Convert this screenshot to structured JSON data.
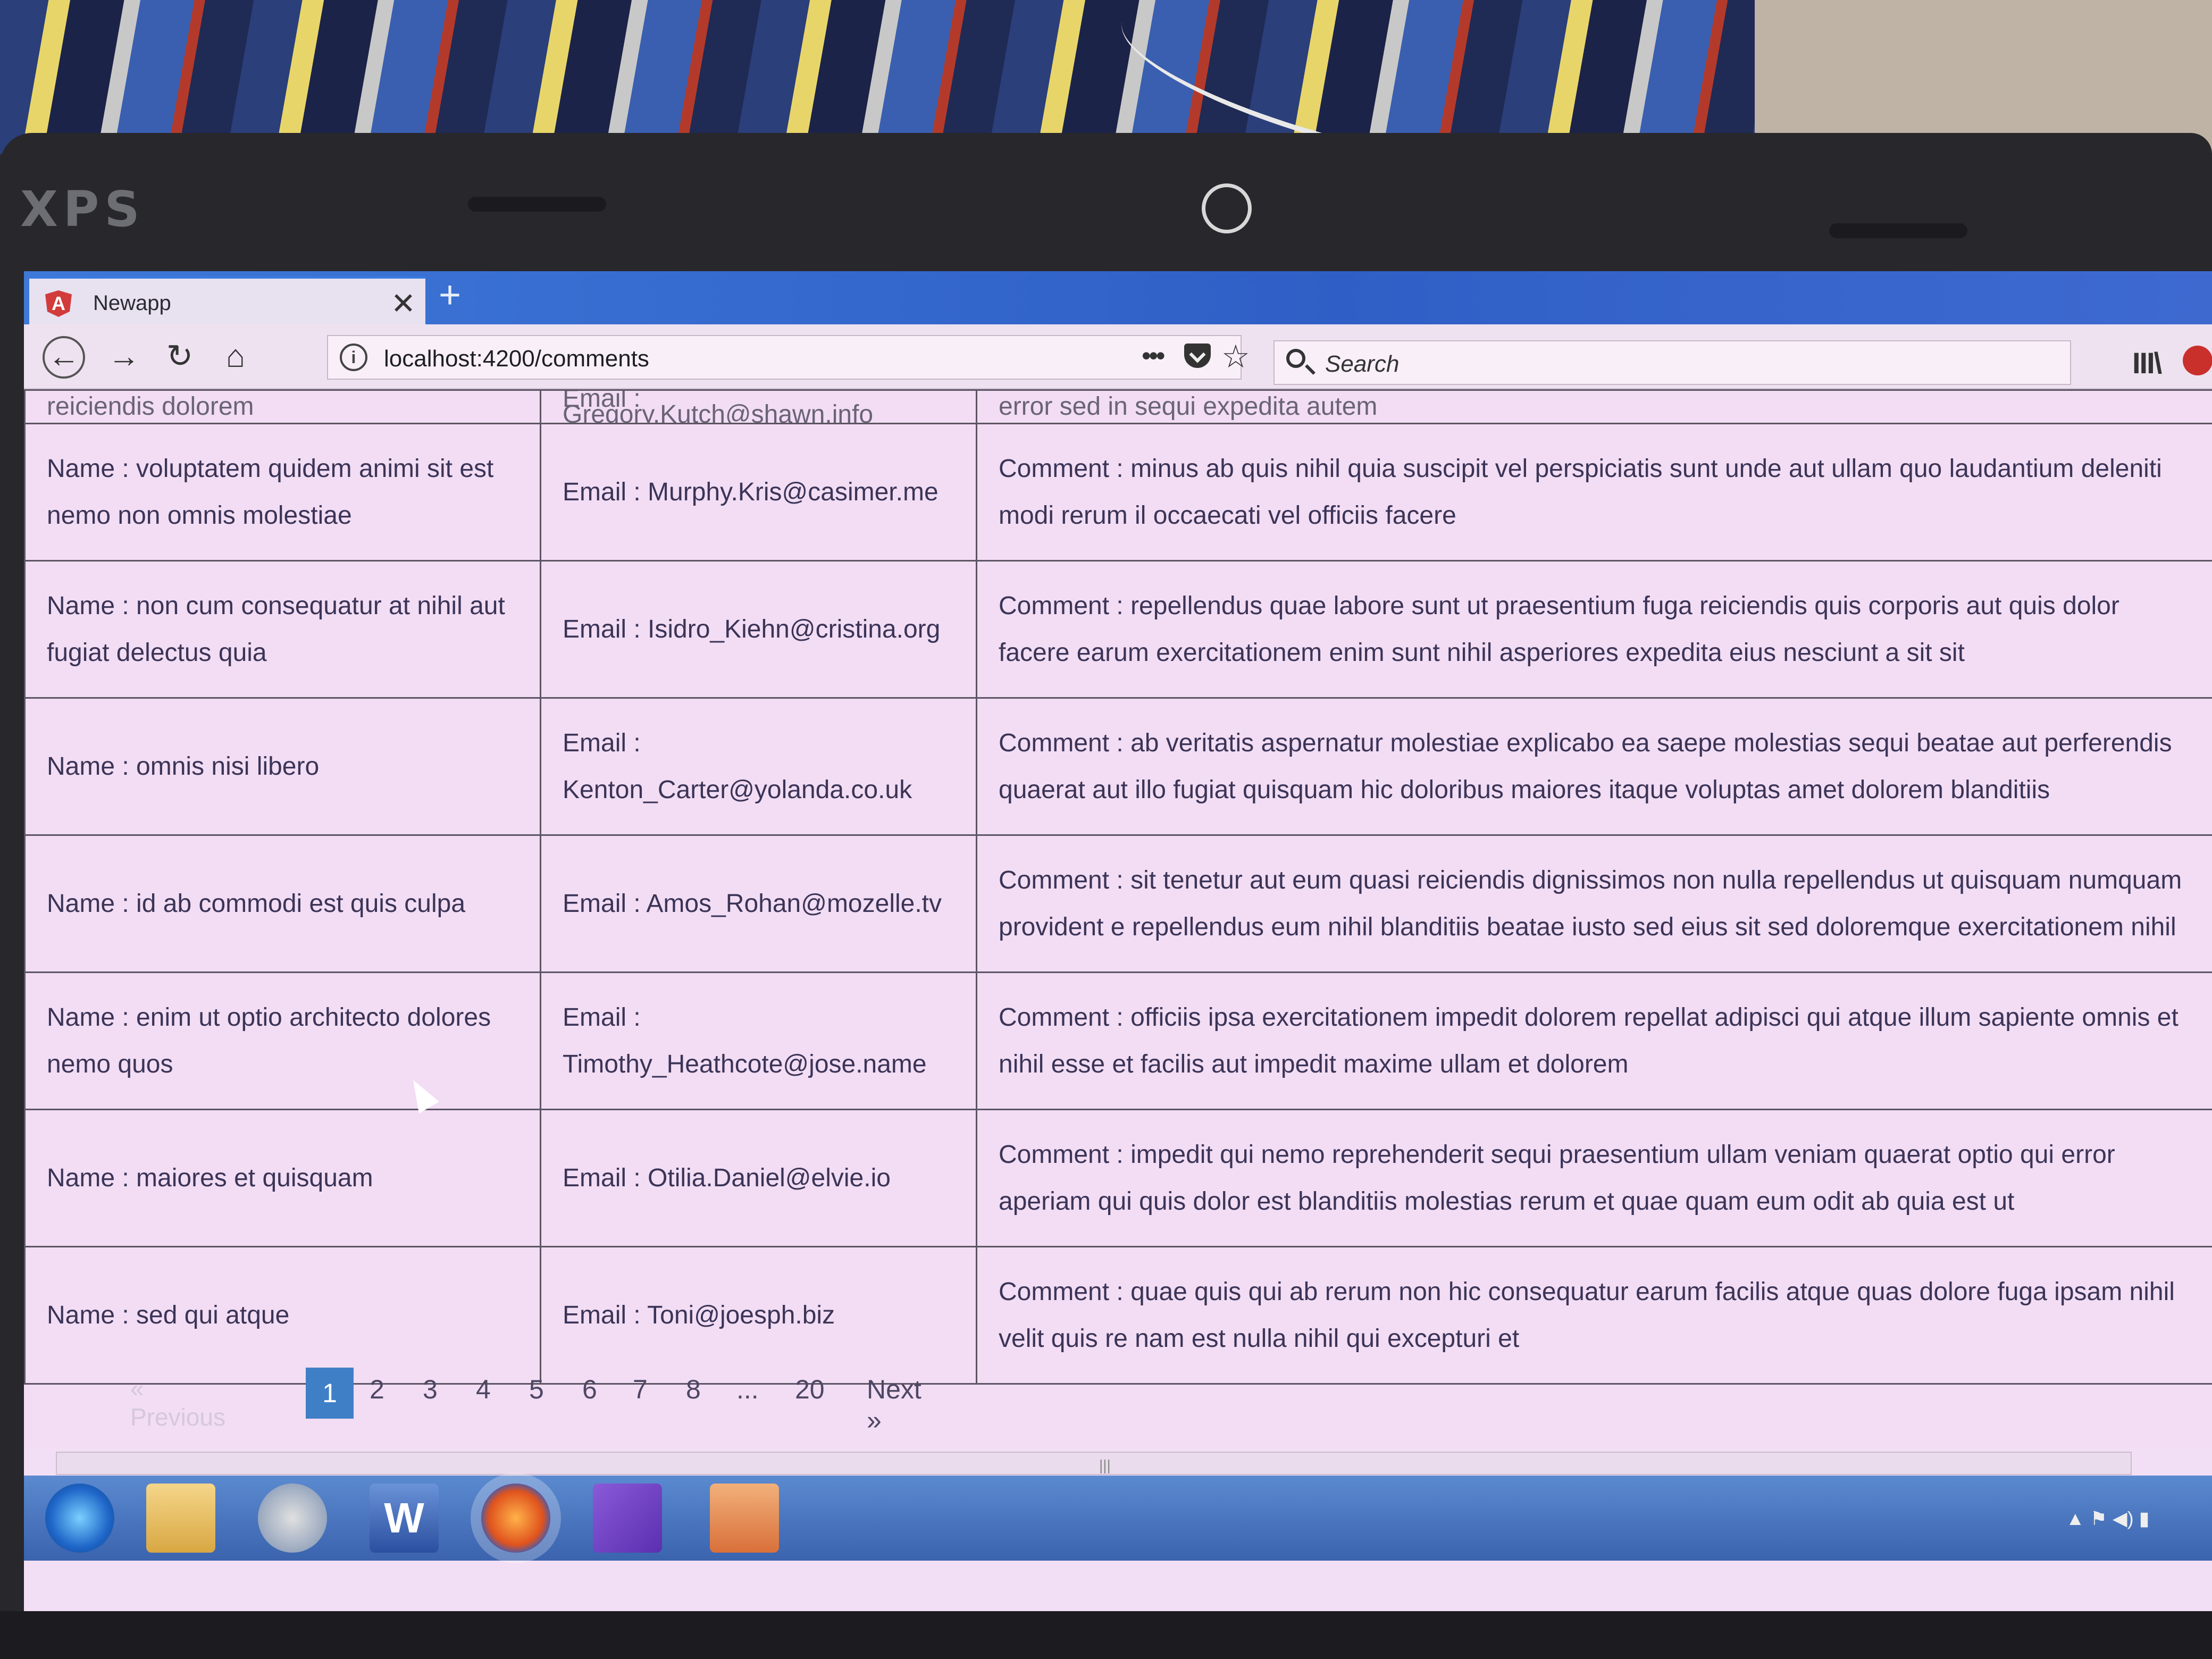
{
  "device": {
    "brand": "XPS"
  },
  "browser": {
    "tab_title": "Newapp",
    "tab_close": "✕",
    "new_tab": "+",
    "url": "localhost:4200/comments",
    "more": "•••",
    "search_placeholder": "Search",
    "library_icon": "III\\"
  },
  "table": {
    "partial_row": {
      "name": "reiciendis dolorem",
      "email": "Email : Gregory.Kutch@shawn.info",
      "comment": "error sed in sequi expedita autem"
    },
    "rows": [
      {
        "name": "Name : voluptatem quidem animi sit est nemo non omnis molestiae",
        "email": "Email : Murphy.Kris@casimer.me",
        "comment": "Comment : minus ab quis nihil quia suscipit vel perspiciatis sunt unde aut ullam quo laudantium deleniti modi rerum il occaecati vel officiis facere"
      },
      {
        "name": "Name : non cum consequatur at nihil aut fugiat delectus quia",
        "email": "Email : Isidro_Kiehn@cristina.org",
        "comment": "Comment : repellendus quae labore sunt ut praesentium fuga reiciendis quis corporis aut quis dolor facere earum exercitationem enim sunt nihil asperiores expedita eius nesciunt a sit sit"
      },
      {
        "name": "Name : omnis nisi libero",
        "email": "Email : Kenton_Carter@yolanda.co.uk",
        "comment": "Comment : ab veritatis aspernatur molestiae explicabo ea saepe molestias sequi beatae aut perferendis quaerat aut illo fugiat quisquam hic doloribus maiores itaque voluptas amet dolorem blanditiis"
      },
      {
        "name": "Name : id ab commodi est quis culpa",
        "email": "Email : Amos_Rohan@mozelle.tv",
        "comment": "Comment : sit tenetur aut eum quasi reiciendis dignissimos non nulla repellendus ut quisquam numquam provident e repellendus eum nihil blanditiis beatae iusto sed eius sit sed doloremque exercitationem nihil"
      },
      {
        "name": "Name : enim ut optio architecto dolores nemo quos",
        "email": "Email : Timothy_Heathcote@jose.name",
        "comment": "Comment : officiis ipsa exercitationem impedit dolorem repellat adipisci qui atque illum sapiente omnis et nihil esse et facilis aut impedit maxime ullam et dolorem"
      },
      {
        "name": "Name : maiores et quisquam",
        "email": "Email : Otilia.Daniel@elvie.io",
        "comment": "Comment : impedit qui nemo reprehenderit sequi praesentium ullam veniam quaerat optio qui error aperiam qui quis dolor est blanditiis molestias rerum et quae quam eum odit ab quia est ut"
      },
      {
        "name": "Name : sed qui atque",
        "email": "Email : Toni@joesph.biz",
        "comment": "Comment : quae quis qui ab rerum non hic consequatur earum facilis atque quas dolore fuga ipsam nihil velit quis re nam est nulla nihil qui excepturi et"
      }
    ]
  },
  "pagination": {
    "previous": "« Previous",
    "pages": [
      "1",
      "2",
      "3",
      "4",
      "5",
      "6",
      "7",
      "8",
      "...",
      "20"
    ],
    "current": "1",
    "next": "Next  »"
  },
  "taskbar": {
    "word_letter": "W",
    "tray": "▲ ⚑ ◀) ▮"
  }
}
